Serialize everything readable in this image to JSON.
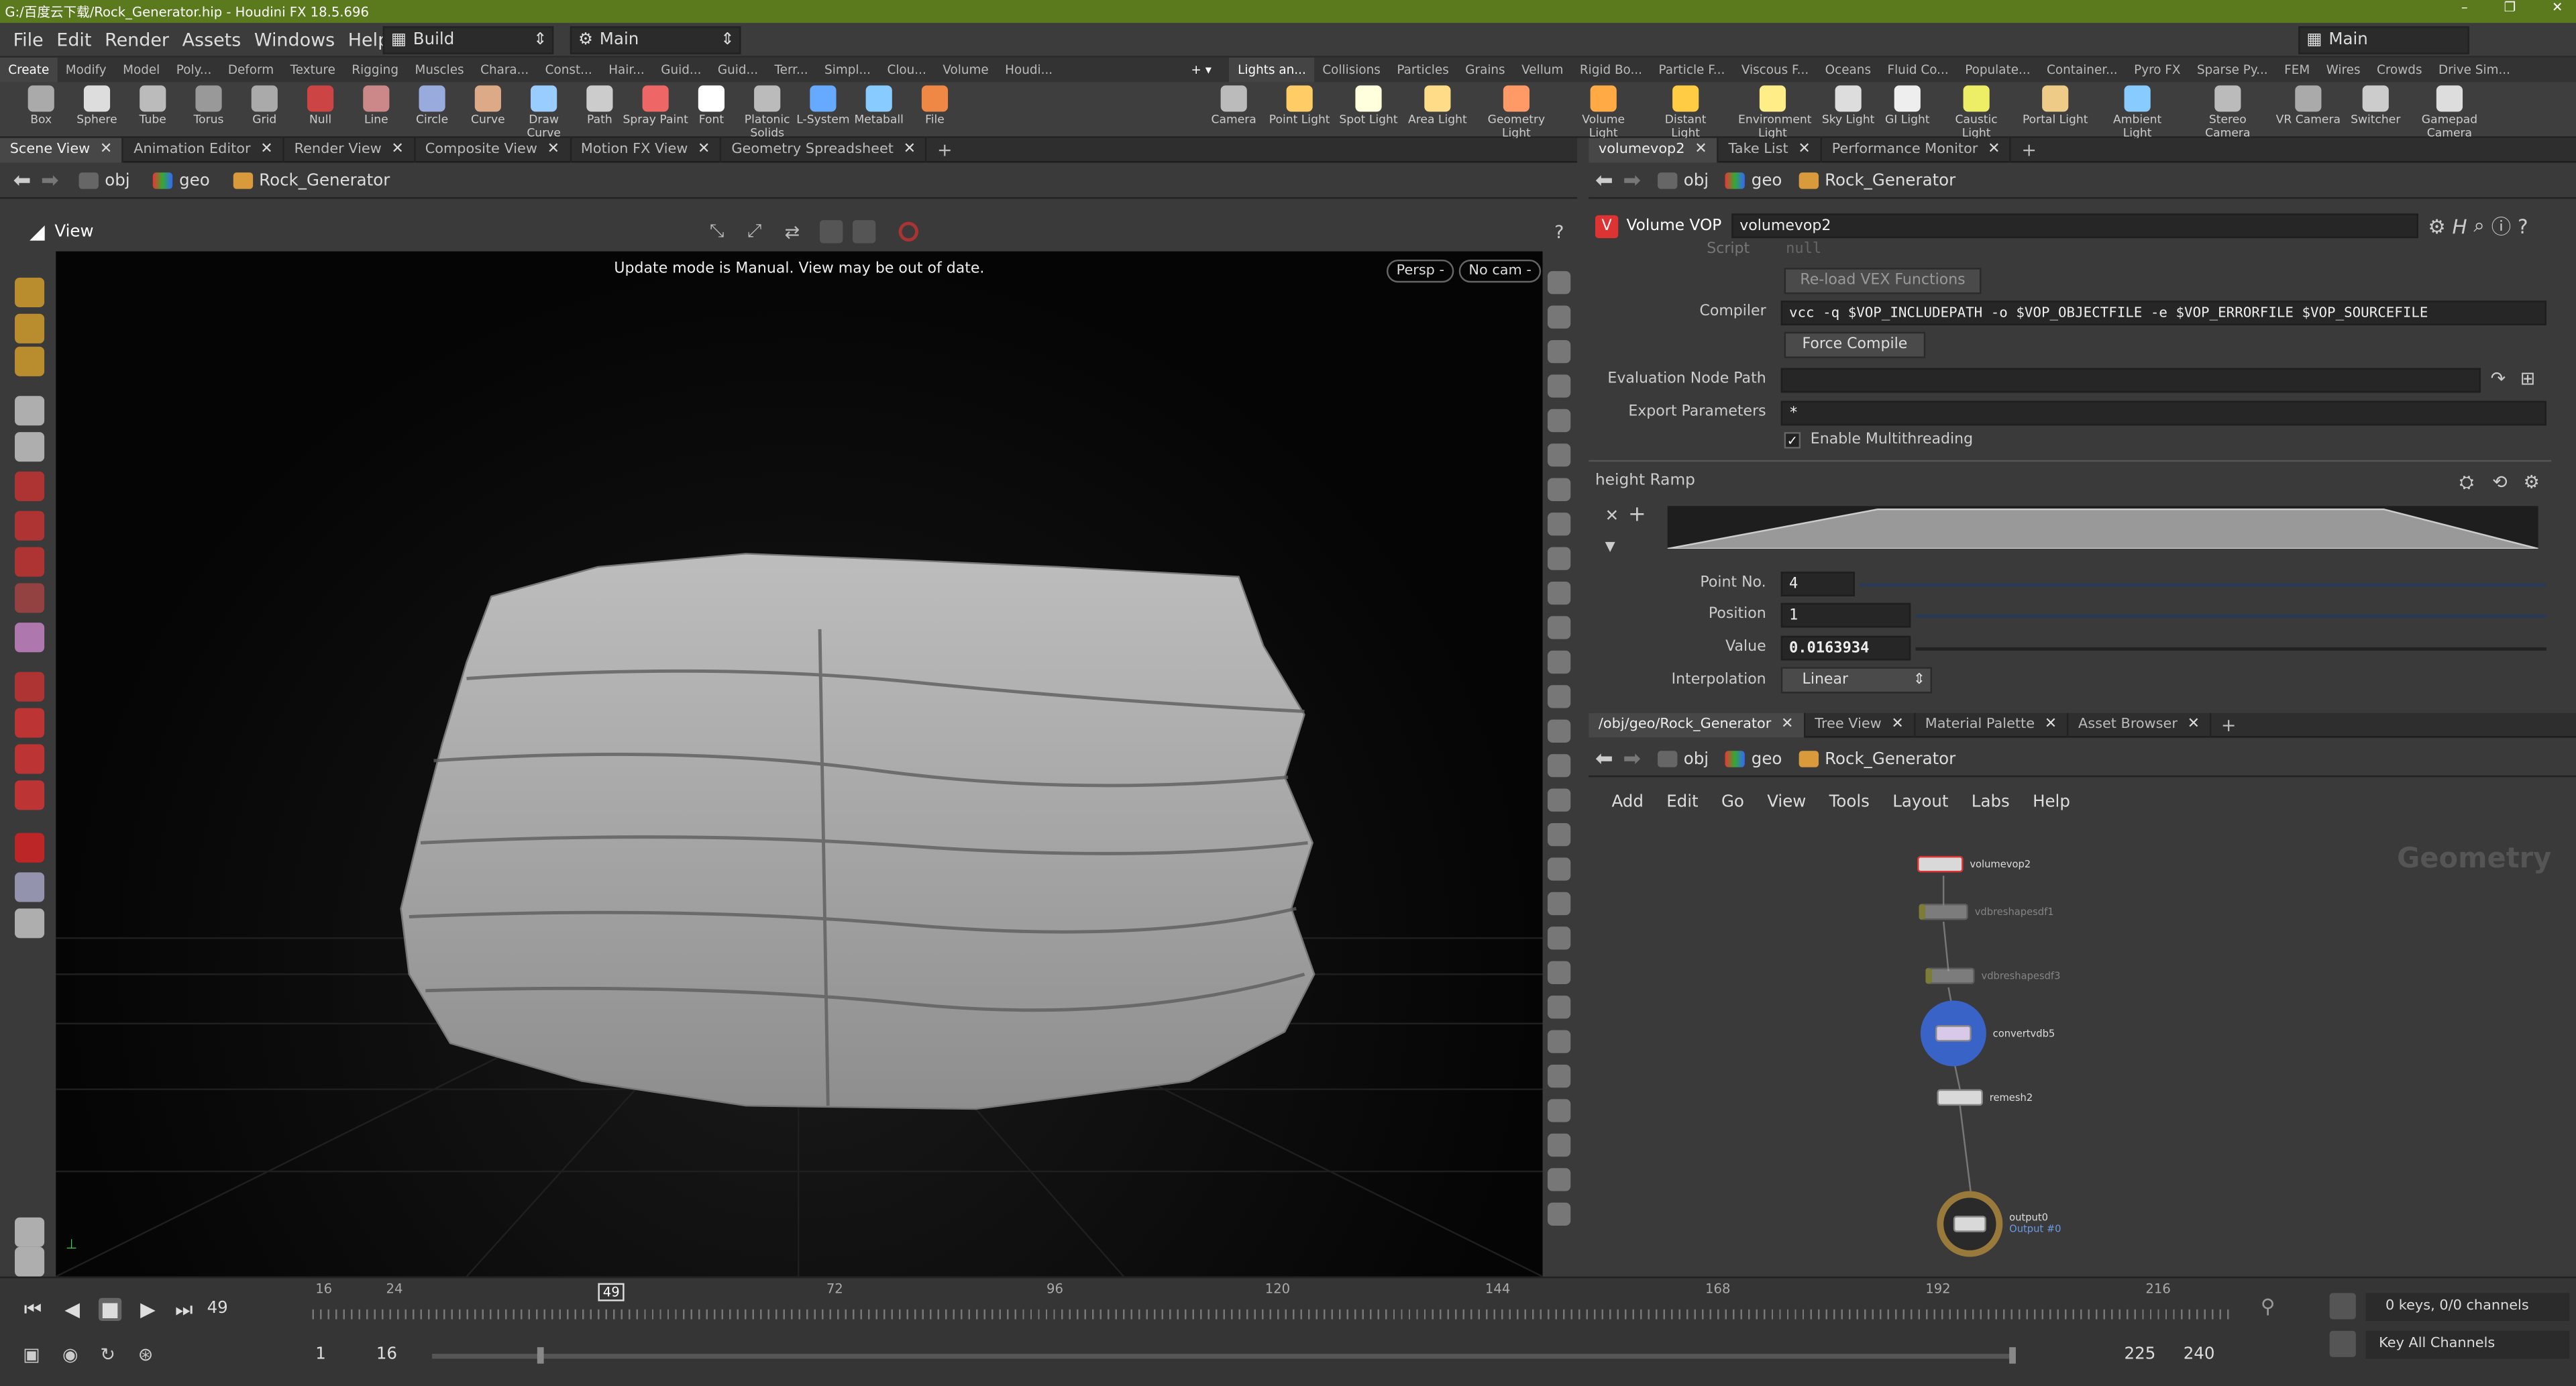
{
  "window": {
    "title": "G:/百度云下载/Rock_Generator.hip - Houdini FX 18.5.696"
  },
  "menubar": {
    "items": [
      "File",
      "Edit",
      "Render",
      "Assets",
      "Windows",
      "Help"
    ],
    "desktop": "Build",
    "runtime": "Main",
    "right_desktop": "Main"
  },
  "shelf_tabs_left": [
    "Create",
    "Modify",
    "Model",
    "Poly...",
    "Deform",
    "Texture",
    "Rigging",
    "Muscles",
    "Chara...",
    "Const...",
    "Hair...",
    "Guid...",
    "Guid...",
    "Terr...",
    "Simpl...",
    "Clou...",
    "Volume",
    "Houdi..."
  ],
  "shelf_tabs_right": [
    "Lights an...",
    "Collisions",
    "Particles",
    "Grains",
    "Vellum",
    "Rigid Bo...",
    "Particle F...",
    "Viscous F...",
    "Oceans",
    "Fluid Co...",
    "Populate...",
    "Container...",
    "Pyro FX",
    "Sparse Py...",
    "FEM",
    "Wires",
    "Crowds",
    "Drive Sim..."
  ],
  "tools_left": [
    "Box",
    "Sphere",
    "Tube",
    "Torus",
    "Grid",
    "Null",
    "Line",
    "Circle",
    "Curve",
    "Draw Curve",
    "Path",
    "Spray Paint",
    "Font",
    "Platonic Solids",
    "L-System",
    "Metaball",
    "File"
  ],
  "tools_right": [
    "Camera",
    "Point Light",
    "Spot Light",
    "Area Light",
    "Geometry Light",
    "Volume Light",
    "Distant Light",
    "Environment Light",
    "Sky Light",
    "GI Light",
    "Caustic Light",
    "Portal Light",
    "Ambient Light",
    "Stereo Camera",
    "VR Camera",
    "Switcher",
    "Gamepad Camera"
  ],
  "left_tabs": [
    "Scene View",
    "Animation Editor",
    "Render View",
    "Composite View",
    "Motion FX View",
    "Geometry Spreadsheet"
  ],
  "path": {
    "obj": "obj",
    "geo": "geo",
    "node": "Rock_Generator"
  },
  "viewport": {
    "label": "View",
    "message": "Update mode is Manual. View may be out of date.",
    "persp": "Persp -",
    "cam": "No cam -"
  },
  "right_top_tabs": [
    "volumevop2",
    "Take List",
    "Performance Monitor"
  ],
  "params": {
    "node_type": "Volume VOP",
    "node_name": "volumevop2",
    "script_label": "Script",
    "script_value": "null",
    "reload_button": "Re-load VEX Functions",
    "compiler_label": "Compiler",
    "compiler_value": "vcc -q $VOP_INCLUDEPATH -o $VOP_OBJECTFILE -e $VOP_ERRORFILE $VOP_SOURCEFILE",
    "force_compile": "Force Compile",
    "eval_label": "Evaluation Node Path",
    "eval_value": "",
    "export_label": "Export Parameters",
    "export_value": "*",
    "multithread_label": "Enable Multithreading",
    "ramp_label": "height Ramp",
    "point_no_label": "Point No.",
    "point_no_value": "4",
    "position_label": "Position",
    "position_value": "1",
    "value_label": "Value",
    "value_value": "0.0163934",
    "interp_label": "Interpolation",
    "interp_value": "Linear"
  },
  "right_bottom_tabs": [
    "/obj/geo/Rock_Generator",
    "Tree View",
    "Material Palette",
    "Asset Browser"
  ],
  "network_menu": [
    "Add",
    "Edit",
    "Go",
    "View",
    "Tools",
    "Layout",
    "Labs",
    "Help"
  ],
  "network": {
    "watermark": "Geometry",
    "nodes": [
      "volumevop2",
      "vdbreshapesdf1",
      "vdbreshapesdf3",
      "convertvdb5",
      "remesh2",
      "output0"
    ],
    "output_sub": "Output #0"
  },
  "timeline": {
    "current_frame": "49",
    "ticks": [
      "16",
      "24",
      "49",
      "72",
      "96",
      "120",
      "144",
      "168",
      "192",
      "216"
    ],
    "range_start": "1",
    "range_start2": "16",
    "range_end": "225",
    "range_end2": "240",
    "keys": "0 keys, 0/0 channels",
    "key_all": "Key All Channels"
  }
}
